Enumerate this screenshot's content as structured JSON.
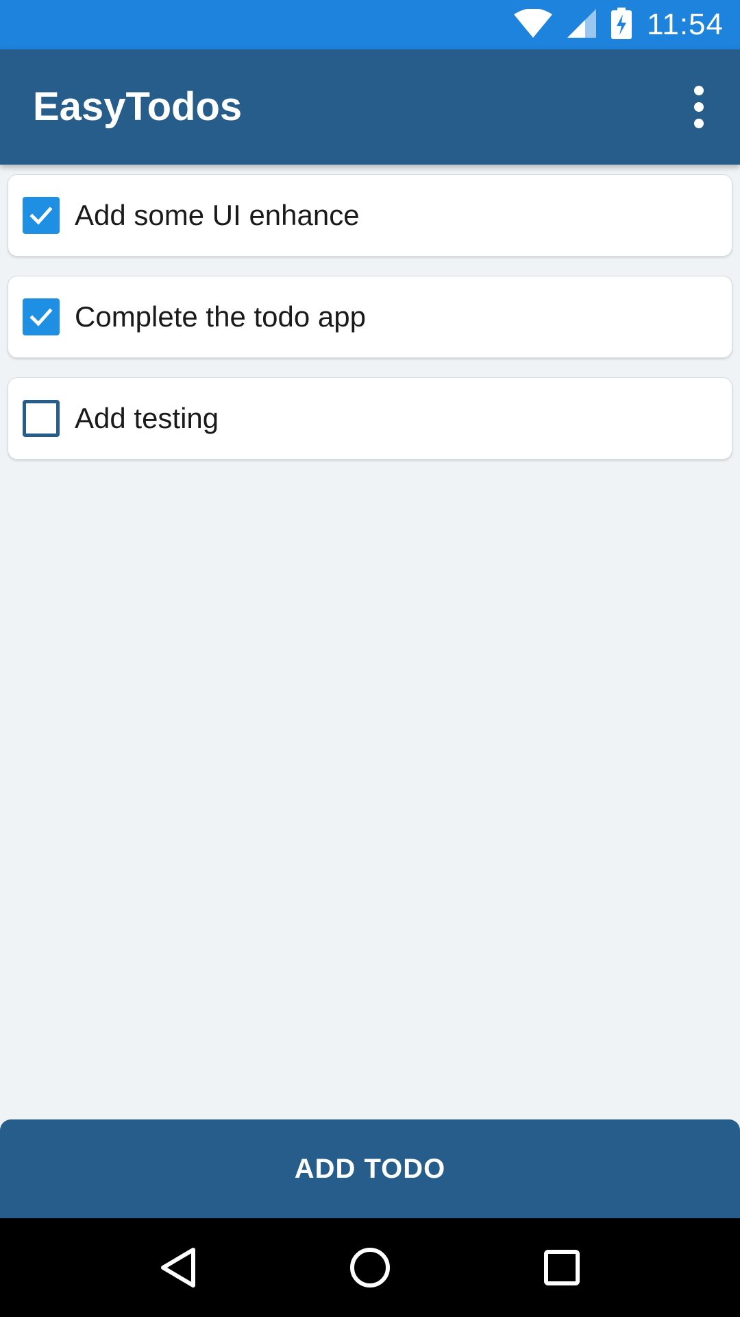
{
  "status_bar": {
    "time": "11:54",
    "icons": [
      "wifi-icon",
      "cell-signal-icon",
      "battery-charging-icon"
    ]
  },
  "app_bar": {
    "title": "EasyTodos",
    "overflow_icon": "more-vert-icon"
  },
  "todos": [
    {
      "label": "Add some UI enhance",
      "checked": true
    },
    {
      "label": "Complete the todo app",
      "checked": true
    },
    {
      "label": "Add testing",
      "checked": false
    }
  ],
  "add_button": {
    "label": "ADD TODO"
  },
  "nav_bar": {
    "icons": [
      "back-icon",
      "home-icon",
      "recents-icon"
    ]
  },
  "colors": {
    "status_bar": "#1e83dc",
    "app_bar": "#265d8b",
    "checkbox_checked": "#1e8fe3",
    "background": "#eff3f6"
  }
}
